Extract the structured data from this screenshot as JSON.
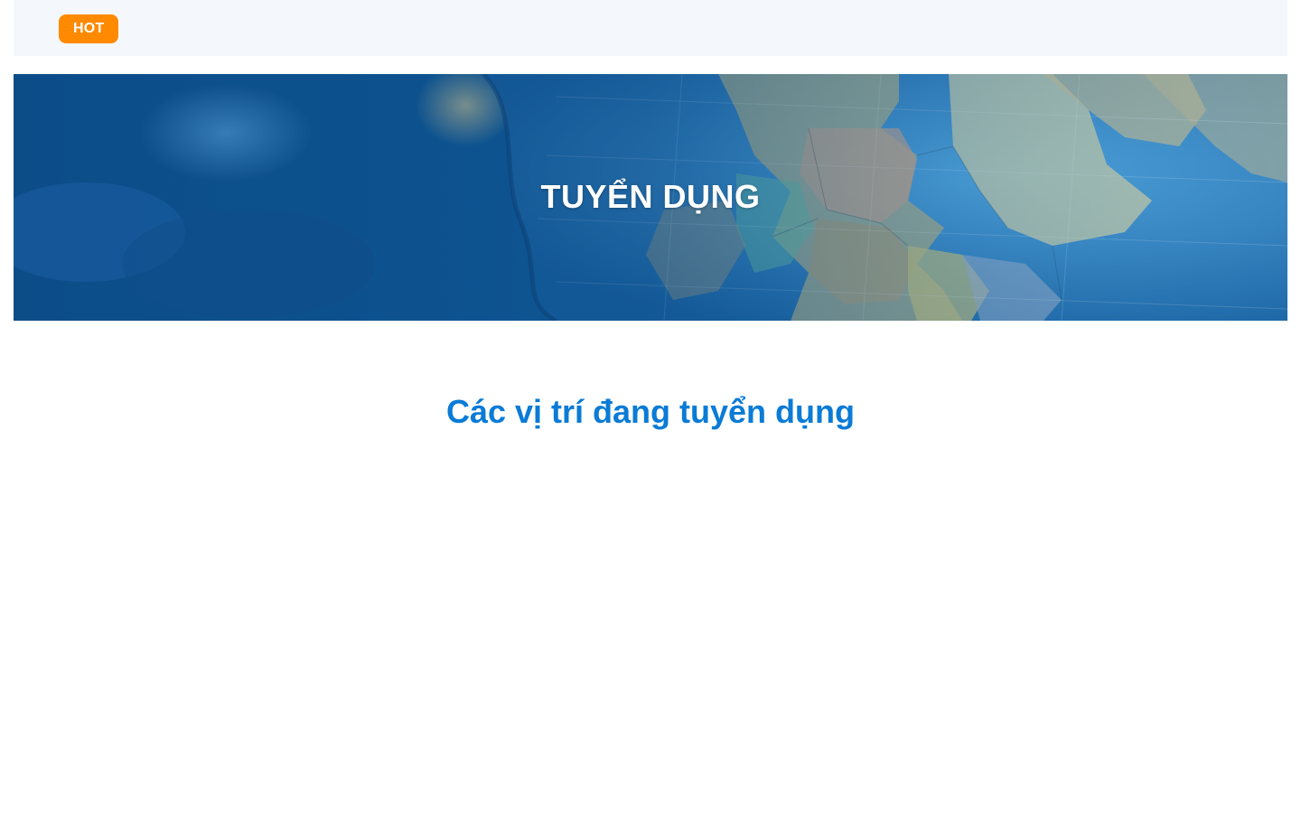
{
  "header": {
    "hot_badge": "HOT",
    "hot_color": "#ff8a00"
  },
  "hero": {
    "title": "TUYỂN DỤNG",
    "background": "globe-map-image",
    "overlay_color": "#0b5aa0"
  },
  "main": {
    "section_title": "Các vị trí đang tuyển dụng",
    "accent_color": "#0a7bd6"
  }
}
